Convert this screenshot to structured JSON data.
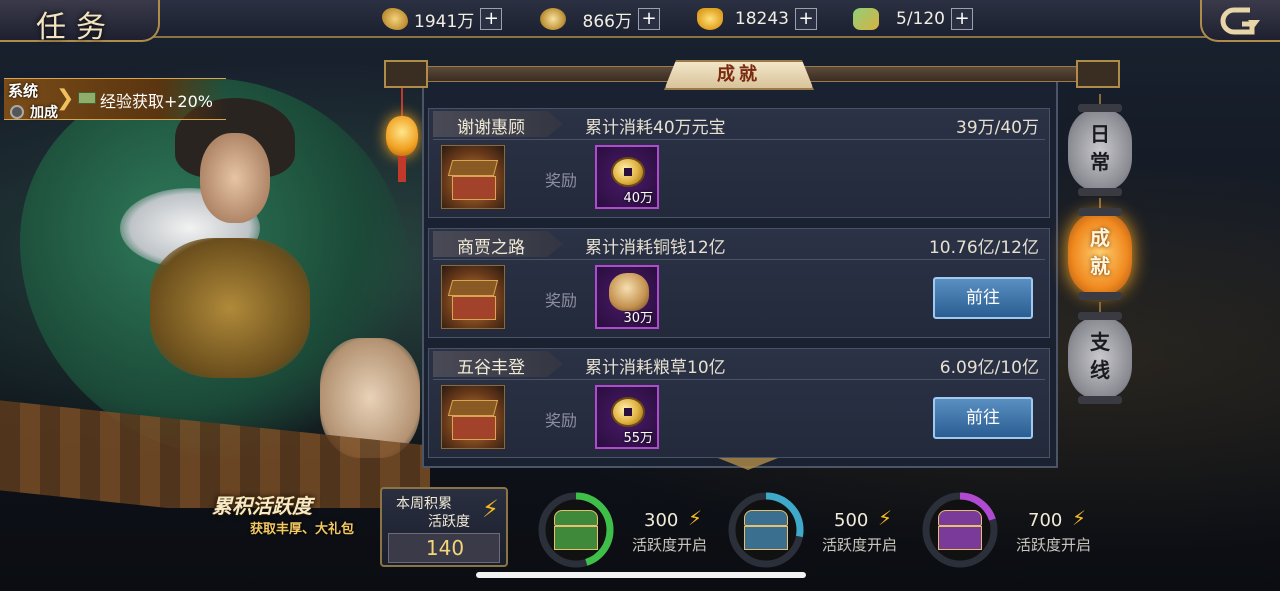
{
  "header": {
    "title": "任务",
    "resources": [
      {
        "icon": "grain-icon",
        "value": "1941万",
        "plus": "+"
      },
      {
        "icon": "copper-coin-icon",
        "value": "866万",
        "plus": "+"
      },
      {
        "icon": "gold-ingot-icon",
        "value": "18243",
        "plus": "+"
      },
      {
        "icon": "stamina-icon",
        "value": "5/120",
        "plus": "+"
      }
    ],
    "back_icon": "back-arrow-icon"
  },
  "bonus": {
    "sys": "系统",
    "add": "加成",
    "text": "经验获取+20%"
  },
  "panel": {
    "active_tab": "成就",
    "reward_label": "奖励",
    "rows": [
      {
        "name": "谢谢惠顾",
        "desc": "累计消耗40万元宝",
        "progress": "39万/40万",
        "reward_icon": "copper-coin-icon",
        "reward_count": "40万",
        "button": ""
      },
      {
        "name": "商贾之路",
        "desc": "累计消耗铜钱12亿",
        "progress": "10.76亿/12亿",
        "reward_icon": "money-bag-icon",
        "reward_count": "30万",
        "button": "前往"
      },
      {
        "name": "五谷丰登",
        "desc": "累计消耗粮草10亿",
        "progress": "6.09亿/10亿",
        "reward_icon": "copper-coin-icon",
        "reward_count": "55万",
        "button": "前往"
      }
    ]
  },
  "side_tabs": [
    {
      "label_1": "日",
      "label_2": "常",
      "active": false
    },
    {
      "label_1": "成",
      "label_2": "就",
      "active": true
    },
    {
      "label_1": "支",
      "label_2": "线",
      "active": false
    }
  ],
  "activity": {
    "title": "累积活跃度",
    "subtitle": "获取丰厚、大礼包",
    "weekly_label_1": "本周积累",
    "weekly_label_2": "活跃度",
    "weekly_value": "140",
    "milestones": [
      {
        "value": "300",
        "label": "活跃度开启",
        "progress": 0.45,
        "ring_color": "#3fbf4a",
        "chest_color": "#3f8a3a"
      },
      {
        "value": "500",
        "label": "活跃度开启",
        "progress": 0.28,
        "ring_color": "#3fa9c9",
        "chest_color": "#3a6f8f"
      },
      {
        "value": "700",
        "label": "活跃度开启",
        "progress": 0.2,
        "ring_color": "#b04ad0",
        "chest_color": "#7a3a9a"
      }
    ]
  }
}
